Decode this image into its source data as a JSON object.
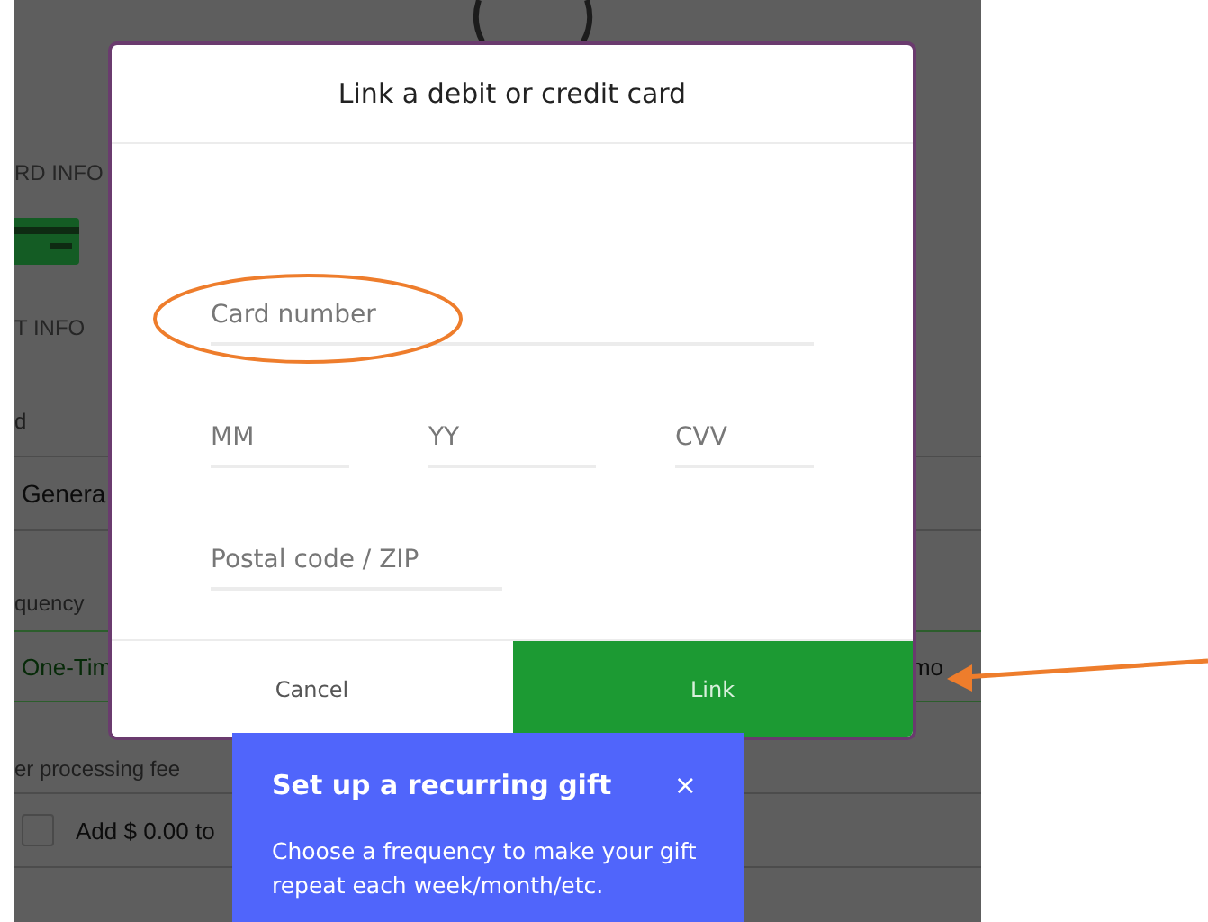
{
  "background_page": {
    "card_info_heading": "RD INFO",
    "payment_info_heading": "T INFO",
    "fund_label": "d",
    "fund_value": "Genera",
    "frequency_label": "quency",
    "frequency_options": [
      {
        "label": "One-Tim",
        "selected": true
      },
      {
        "label": "mo",
        "selected": false
      }
    ],
    "fee_label": "er processing fee",
    "fee_option": {
      "label": "Add $ 0.00 to",
      "checked": false
    }
  },
  "dialog": {
    "title": "Link a debit or credit card",
    "field_rows": [
      [
        {
          "placeholder": "Card number",
          "kind": "wide"
        }
      ],
      [
        {
          "placeholder": "MM",
          "kind": "short"
        },
        {
          "placeholder": "YY",
          "kind": "medium"
        },
        {
          "placeholder": "CVV",
          "kind": "short"
        }
      ],
      [
        {
          "placeholder": "Postal code / ZIP",
          "kind": "half"
        }
      ]
    ],
    "buttons": [
      {
        "label": "Cancel",
        "kind": "secondary"
      },
      {
        "label": "Link",
        "kind": "primary"
      }
    ]
  },
  "tooltip": {
    "title": "Set up a recurring gift",
    "close": "×",
    "body": "Choose a frequency to make your gift repeat each week/month/etc."
  }
}
